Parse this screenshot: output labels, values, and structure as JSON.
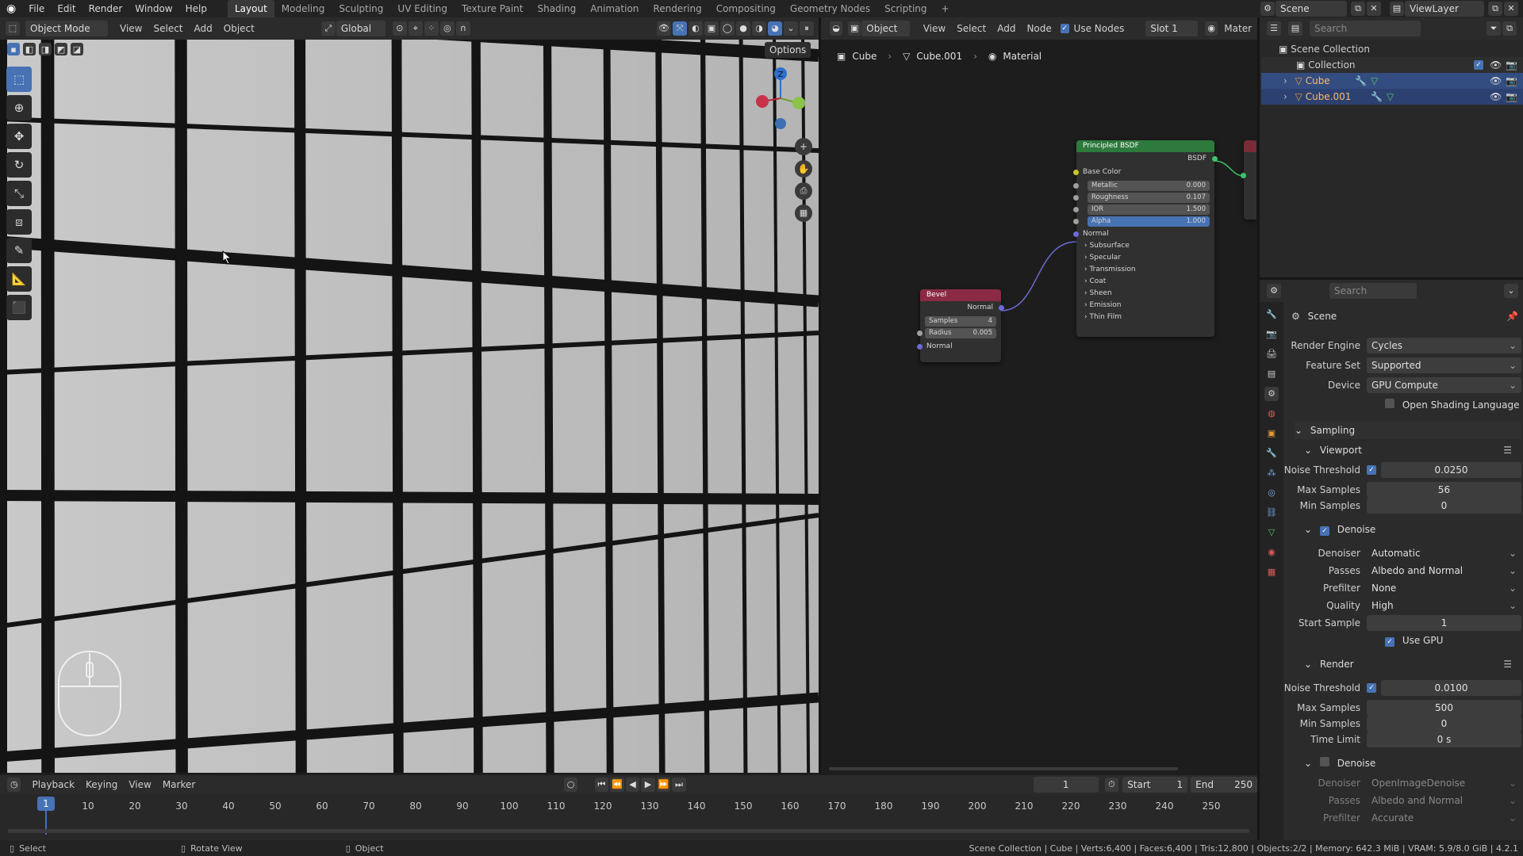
{
  "topbar": {
    "menus": [
      "File",
      "Edit",
      "Render",
      "Window",
      "Help"
    ],
    "workspaces": [
      "Layout",
      "Modeling",
      "Sculpting",
      "UV Editing",
      "Texture Paint",
      "Shading",
      "Animation",
      "Rendering",
      "Compositing",
      "Geometry Nodes",
      "Scripting"
    ],
    "active_workspace": "Layout",
    "scene": "Scene",
    "view_layer": "ViewLayer"
  },
  "viewport": {
    "mode": "Object Mode",
    "menus": [
      "View",
      "Select",
      "Add",
      "Object"
    ],
    "orientation": "Global",
    "options_label": "Options"
  },
  "node_editor": {
    "object_dd": "Object",
    "menus": [
      "View",
      "Select",
      "Add",
      "Node"
    ],
    "use_nodes": "Use Nodes",
    "slot": "Slot 1",
    "material_short": "Mater",
    "breadcrumb": [
      "Cube",
      "Cube.001",
      "Material"
    ],
    "bsdf": {
      "title": "Principled BSDF",
      "output": "BSDF",
      "base_color": "Base Color",
      "fields": [
        {
          "label": "Metallic",
          "value": "0.000"
        },
        {
          "label": "Roughness",
          "value": "0.107"
        },
        {
          "label": "IOR",
          "value": "1.500"
        },
        {
          "label": "Alpha",
          "value": "1.000"
        }
      ],
      "normal": "Normal",
      "panels": [
        "Subsurface",
        "Specular",
        "Transmission",
        "Coat",
        "Sheen",
        "Emission",
        "Thin Film"
      ]
    },
    "bevel": {
      "title": "Bevel",
      "output": "Normal",
      "samples_label": "Samples",
      "samples_value": "4",
      "radius_label": "Radius",
      "radius_value": "0.005",
      "input": "Normal"
    }
  },
  "outliner": {
    "search_placeholder": "Search",
    "root": "Scene Collection",
    "collection": "Collection",
    "objects": [
      "Cube",
      "Cube.001"
    ]
  },
  "properties": {
    "search_placeholder": "Search",
    "context": "Scene",
    "render_engine_label": "Render Engine",
    "render_engine": "Cycles",
    "feature_set_label": "Feature Set",
    "feature_set": "Supported",
    "device_label": "Device",
    "device": "GPU Compute",
    "osl": "Open Shading Language",
    "sampling": "Sampling",
    "viewport": "Viewport",
    "noise_threshold_label": "Noise Threshold",
    "vp_noise": "0.0250",
    "max_samples_label": "Max Samples",
    "vp_max": "56",
    "min_samples_label": "Min Samples",
    "vp_min": "0",
    "denoise": "Denoise",
    "denoiser_label": "Denoiser",
    "denoiser": "Automatic",
    "passes_label": "Passes",
    "passes": "Albedo and Normal",
    "prefilter_label": "Prefilter",
    "prefilter": "None",
    "quality_label": "Quality",
    "quality": "High",
    "start_sample_label": "Start Sample",
    "start_sample": "1",
    "use_gpu": "Use GPU",
    "render": "Render",
    "r_noise": "0.0100",
    "r_max": "500",
    "r_min": "0",
    "time_limit_label": "Time Limit",
    "time_limit": "0 s",
    "r_denoiser": "OpenImageDenoise",
    "r_passes": "Albedo and Normal",
    "r_prefilter": "Accurate"
  },
  "timeline": {
    "menus": [
      "Playback",
      "Keying",
      "View",
      "Marker"
    ],
    "current_frame": "1",
    "start_label": "Start",
    "start": "1",
    "end_label": "End",
    "end": "250",
    "ticks": [
      "1",
      "10",
      "20",
      "30",
      "40",
      "50",
      "60",
      "70",
      "80",
      "90",
      "100",
      "110",
      "120",
      "130",
      "140",
      "150",
      "160",
      "170",
      "180",
      "190",
      "200",
      "210",
      "220",
      "230",
      "240",
      "250"
    ]
  },
  "statusbar": {
    "select": "Select",
    "rotate": "Rotate View",
    "object": "Object",
    "stats": "Scene Collection | Cube | Verts:6,400 | Faces:6,400 | Tris:12,800 | Objects:2/2 | Memory: 642.3 MiB | VRAM: 5.9/8.0 GiB | 4.2.1"
  }
}
